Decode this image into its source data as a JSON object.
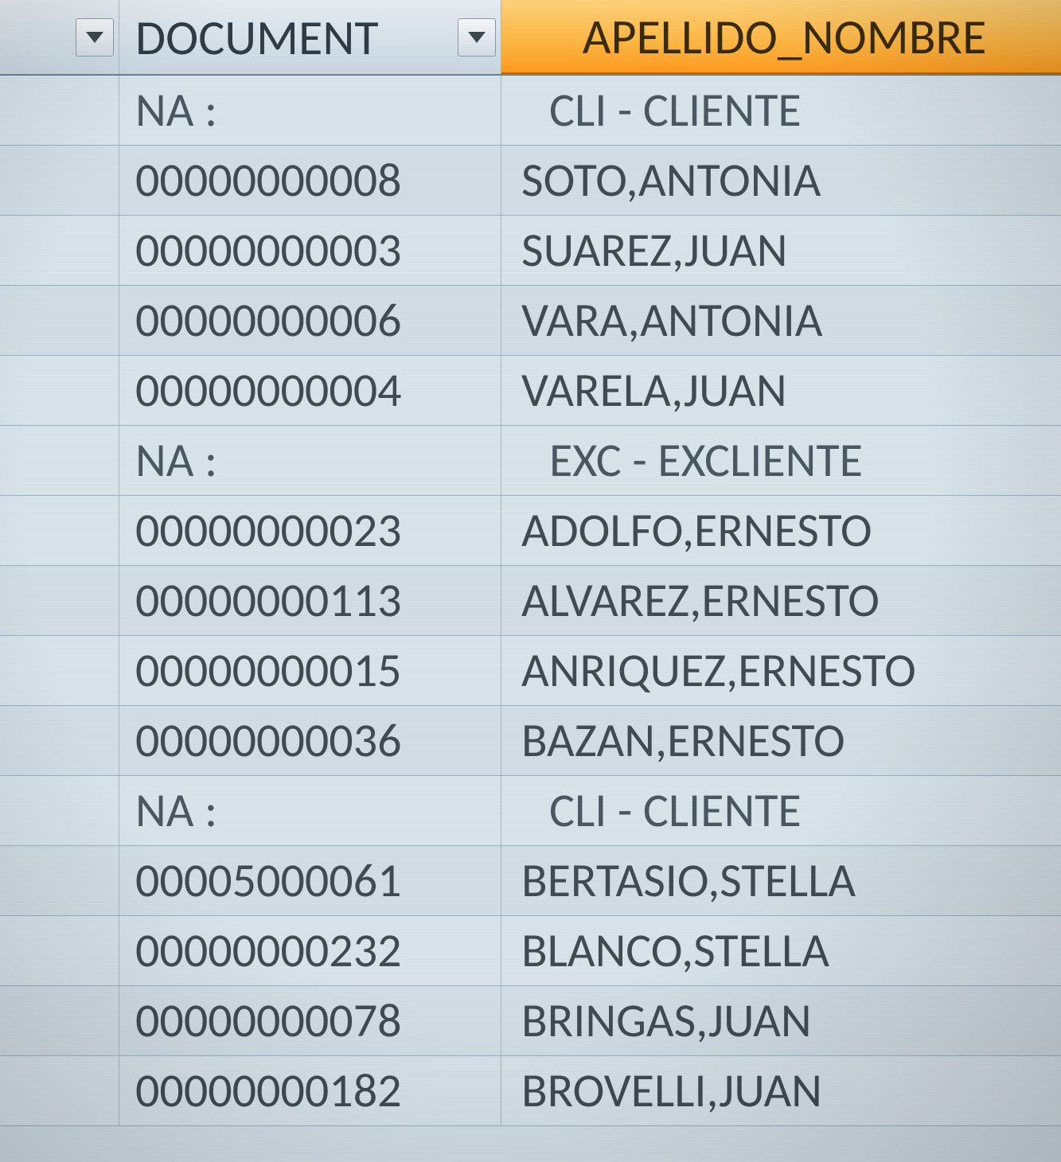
{
  "headers": {
    "col_a": "",
    "col_b": "DOCUMENT",
    "col_c": "APELLIDO_NOMBRE"
  },
  "rows": [
    {
      "type": "group",
      "document": "NA     :",
      "name": "CLI  - CLIENTE"
    },
    {
      "type": "data",
      "document": "00000000008",
      "name": "SOTO,ANTONIA"
    },
    {
      "type": "data",
      "document": "00000000003",
      "name": "SUAREZ,JUAN"
    },
    {
      "type": "data",
      "document": "00000000006",
      "name": "VARA,ANTONIA"
    },
    {
      "type": "data",
      "document": "00000000004",
      "name": "VARELA,JUAN"
    },
    {
      "type": "group",
      "document": "NA     :",
      "name": "EXC  - EXCLIENTE"
    },
    {
      "type": "data",
      "document": "00000000023",
      "name": "ADOLFO,ERNESTO"
    },
    {
      "type": "data",
      "document": "00000000113",
      "name": "ALVAREZ,ERNESTO"
    },
    {
      "type": "data",
      "document": "00000000015",
      "name": "ANRIQUEZ,ERNESTO"
    },
    {
      "type": "data",
      "document": "00000000036",
      "name": "BAZAN,ERNESTO"
    },
    {
      "type": "group",
      "document": "NA     :",
      "name": "CLI  - CLIENTE"
    },
    {
      "type": "data",
      "document": "00005000061",
      "name": "BERTASIO,STELLA"
    },
    {
      "type": "data",
      "document": "00000000232",
      "name": "BLANCO,STELLA"
    },
    {
      "type": "data",
      "document": "00000000078",
      "name": "BRINGAS,JUAN"
    },
    {
      "type": "data",
      "document": "00000000182",
      "name": "BROVELLI,JUAN"
    }
  ]
}
